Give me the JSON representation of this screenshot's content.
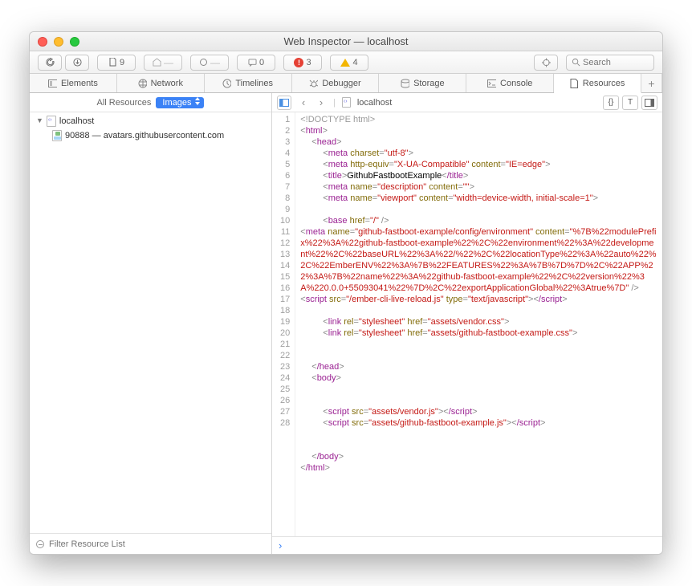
{
  "window": {
    "title": "Web Inspector — localhost"
  },
  "toolbar": {
    "doc_count": "9",
    "comment_count": "0",
    "error_count": "3",
    "warning_count": "4",
    "search_placeholder": "Search"
  },
  "tabs": [
    {
      "label": "Elements"
    },
    {
      "label": "Network"
    },
    {
      "label": "Timelines"
    },
    {
      "label": "Debugger"
    },
    {
      "label": "Storage"
    },
    {
      "label": "Console"
    },
    {
      "label": "Resources",
      "active": true
    }
  ],
  "sidebar": {
    "heading": "All Resources",
    "filter": "Images",
    "items": [
      {
        "label": "localhost",
        "kind": "page",
        "expanded": true
      },
      {
        "label": "90888 — avatars.githubusercontent.com",
        "kind": "img"
      }
    ],
    "filter_placeholder": "Filter Resource List"
  },
  "contentHead": {
    "crumb": "localhost"
  },
  "lines": [
    {
      "n": 1,
      "in": 0,
      "seg": [
        {
          "t": "<!DOCTYPE html>",
          "c": "doc"
        }
      ]
    },
    {
      "n": 2,
      "in": 0,
      "seg": [
        {
          "t": "<",
          "c": "ang"
        },
        {
          "t": "html",
          "c": "tag"
        },
        {
          "t": ">",
          "c": "ang"
        }
      ]
    },
    {
      "n": 3,
      "in": 1,
      "seg": [
        {
          "t": "<",
          "c": "ang"
        },
        {
          "t": "head",
          "c": "tag"
        },
        {
          "t": ">",
          "c": "ang"
        }
      ]
    },
    {
      "n": 4,
      "in": 2,
      "seg": [
        {
          "t": "<",
          "c": "ang"
        },
        {
          "t": "meta",
          "c": "tag"
        },
        {
          "t": " charset",
          "c": "attr"
        },
        {
          "t": "=",
          "c": "ang"
        },
        {
          "t": "\"utf-8\"",
          "c": "str"
        },
        {
          "t": ">",
          "c": "ang"
        }
      ]
    },
    {
      "n": 5,
      "in": 2,
      "seg": [
        {
          "t": "<",
          "c": "ang"
        },
        {
          "t": "meta",
          "c": "tag"
        },
        {
          "t": " http-equiv",
          "c": "attr"
        },
        {
          "t": "=",
          "c": "ang"
        },
        {
          "t": "\"X-UA-Compatible\"",
          "c": "str"
        },
        {
          "t": " content",
          "c": "attr"
        },
        {
          "t": "=",
          "c": "ang"
        },
        {
          "t": "\"IE=edge\"",
          "c": "str"
        },
        {
          "t": ">",
          "c": "ang"
        }
      ]
    },
    {
      "n": 6,
      "in": 2,
      "seg": [
        {
          "t": "<",
          "c": "ang"
        },
        {
          "t": "title",
          "c": "tag"
        },
        {
          "t": ">",
          "c": "ang"
        },
        {
          "t": "GithubFastbootExample",
          "c": "txt"
        },
        {
          "t": "<",
          "c": "ang"
        },
        {
          "t": "/title",
          "c": "tag"
        },
        {
          "t": ">",
          "c": "ang"
        }
      ]
    },
    {
      "n": 7,
      "in": 2,
      "seg": [
        {
          "t": "<",
          "c": "ang"
        },
        {
          "t": "meta",
          "c": "tag"
        },
        {
          "t": " name",
          "c": "attr"
        },
        {
          "t": "=",
          "c": "ang"
        },
        {
          "t": "\"description\"",
          "c": "str"
        },
        {
          "t": " content",
          "c": "attr"
        },
        {
          "t": "=",
          "c": "ang"
        },
        {
          "t": "\"\"",
          "c": "str"
        },
        {
          "t": ">",
          "c": "ang"
        }
      ]
    },
    {
      "n": 8,
      "in": 2,
      "seg": [
        {
          "t": "<",
          "c": "ang"
        },
        {
          "t": "meta",
          "c": "tag"
        },
        {
          "t": " name",
          "c": "attr"
        },
        {
          "t": "=",
          "c": "ang"
        },
        {
          "t": "\"viewport\"",
          "c": "str"
        },
        {
          "t": " content",
          "c": "attr"
        },
        {
          "t": "=",
          "c": "ang"
        },
        {
          "t": "\"width=device-width, initial-scale=1\"",
          "c": "str"
        },
        {
          "t": ">",
          "c": "ang"
        }
      ]
    },
    {
      "n": 9,
      "in": 0,
      "seg": []
    },
    {
      "n": 10,
      "in": 2,
      "seg": [
        {
          "t": "<",
          "c": "ang"
        },
        {
          "t": "base",
          "c": "tag"
        },
        {
          "t": " href",
          "c": "attr"
        },
        {
          "t": "=",
          "c": "ang"
        },
        {
          "t": "\"/\"",
          "c": "str"
        },
        {
          "t": " />",
          "c": "ang"
        }
      ]
    },
    {
      "n": 11,
      "in": 0,
      "seg": [
        {
          "t": "<",
          "c": "ang"
        },
        {
          "t": "meta",
          "c": "tag"
        },
        {
          "t": " name",
          "c": "attr"
        },
        {
          "t": "=",
          "c": "ang"
        },
        {
          "t": "\"github-fastboot-example/config/environment\"",
          "c": "str"
        },
        {
          "t": " content",
          "c": "attr"
        },
        {
          "t": "=",
          "c": "ang"
        },
        {
          "t": "\"%7B%22modulePrefix%22%3A%22github-fastboot-example%22%2C%22environment%22%3A%22development%22%2C%22baseURL%22%3A%22/%22%2C%22locationType%22%3A%22auto%22%2C%22EmberENV%22%3A%7B%22FEATURES%22%3A%7B%7D%7D%2C%22APP%22%3A%7B%22name%22%3A%22github-fastboot-example%22%2C%22version%22%3A%220.0.0+55093041%22%7D%2C%22exportApplicationGlobal%22%3Atrue%7D\"",
          "c": "str"
        },
        {
          "t": " />",
          "c": "ang"
        }
      ]
    },
    {
      "n": 12,
      "in": 0,
      "seg": [
        {
          "t": "<",
          "c": "ang"
        },
        {
          "t": "script",
          "c": "tag"
        },
        {
          "t": " src",
          "c": "attr"
        },
        {
          "t": "=",
          "c": "ang"
        },
        {
          "t": "\"/ember-cli-live-reload.js\"",
          "c": "str"
        },
        {
          "t": " type",
          "c": "attr"
        },
        {
          "t": "=",
          "c": "ang"
        },
        {
          "t": "\"text/javascript\"",
          "c": "str"
        },
        {
          "t": ">",
          "c": "ang"
        },
        {
          "t": "<",
          "c": "ang"
        },
        {
          "t": "/script",
          "c": "tag"
        },
        {
          "t": ">",
          "c": "ang"
        }
      ]
    },
    {
      "n": 13,
      "in": 0,
      "seg": []
    },
    {
      "n": 14,
      "in": 2,
      "seg": [
        {
          "t": "<",
          "c": "ang"
        },
        {
          "t": "link",
          "c": "tag"
        },
        {
          "t": " rel",
          "c": "attr"
        },
        {
          "t": "=",
          "c": "ang"
        },
        {
          "t": "\"stylesheet\"",
          "c": "str"
        },
        {
          "t": " href",
          "c": "attr"
        },
        {
          "t": "=",
          "c": "ang"
        },
        {
          "t": "\"assets/vendor.css\"",
          "c": "str"
        },
        {
          "t": ">",
          "c": "ang"
        }
      ]
    },
    {
      "n": 15,
      "in": 2,
      "seg": [
        {
          "t": "<",
          "c": "ang"
        },
        {
          "t": "link",
          "c": "tag"
        },
        {
          "t": " rel",
          "c": "attr"
        },
        {
          "t": "=",
          "c": "ang"
        },
        {
          "t": "\"stylesheet\"",
          "c": "str"
        },
        {
          "t": " href",
          "c": "attr"
        },
        {
          "t": "=",
          "c": "ang"
        },
        {
          "t": "\"assets/github-fastboot-example.css\"",
          "c": "str"
        },
        {
          "t": ">",
          "c": "ang"
        }
      ]
    },
    {
      "n": 16,
      "in": 0,
      "seg": []
    },
    {
      "n": 17,
      "in": 0,
      "seg": []
    },
    {
      "n": 18,
      "in": 1,
      "seg": [
        {
          "t": "<",
          "c": "ang"
        },
        {
          "t": "/head",
          "c": "tag"
        },
        {
          "t": ">",
          "c": "ang"
        }
      ]
    },
    {
      "n": 19,
      "in": 1,
      "seg": [
        {
          "t": "<",
          "c": "ang"
        },
        {
          "t": "body",
          "c": "tag"
        },
        {
          "t": ">",
          "c": "ang"
        }
      ]
    },
    {
      "n": 20,
      "in": 0,
      "seg": []
    },
    {
      "n": 21,
      "in": 0,
      "seg": []
    },
    {
      "n": 22,
      "in": 2,
      "seg": [
        {
          "t": "<",
          "c": "ang"
        },
        {
          "t": "script",
          "c": "tag"
        },
        {
          "t": " src",
          "c": "attr"
        },
        {
          "t": "=",
          "c": "ang"
        },
        {
          "t": "\"assets/vendor.js\"",
          "c": "str"
        },
        {
          "t": ">",
          "c": "ang"
        },
        {
          "t": "<",
          "c": "ang"
        },
        {
          "t": "/script",
          "c": "tag"
        },
        {
          "t": ">",
          "c": "ang"
        }
      ]
    },
    {
      "n": 23,
      "in": 2,
      "seg": [
        {
          "t": "<",
          "c": "ang"
        },
        {
          "t": "script",
          "c": "tag"
        },
        {
          "t": " src",
          "c": "attr"
        },
        {
          "t": "=",
          "c": "ang"
        },
        {
          "t": "\"assets/github-fastboot-example.js\"",
          "c": "str"
        },
        {
          "t": ">",
          "c": "ang"
        },
        {
          "t": "<",
          "c": "ang"
        },
        {
          "t": "/script",
          "c": "tag"
        },
        {
          "t": ">",
          "c": "ang"
        }
      ]
    },
    {
      "n": 24,
      "in": 0,
      "seg": []
    },
    {
      "n": 25,
      "in": 0,
      "seg": []
    },
    {
      "n": 26,
      "in": 1,
      "seg": [
        {
          "t": "<",
          "c": "ang"
        },
        {
          "t": "/body",
          "c": "tag"
        },
        {
          "t": ">",
          "c": "ang"
        }
      ]
    },
    {
      "n": 27,
      "in": 0,
      "seg": [
        {
          "t": "<",
          "c": "ang"
        },
        {
          "t": "/html",
          "c": "tag"
        },
        {
          "t": ">",
          "c": "ang"
        }
      ]
    },
    {
      "n": 28,
      "in": 0,
      "seg": []
    }
  ]
}
